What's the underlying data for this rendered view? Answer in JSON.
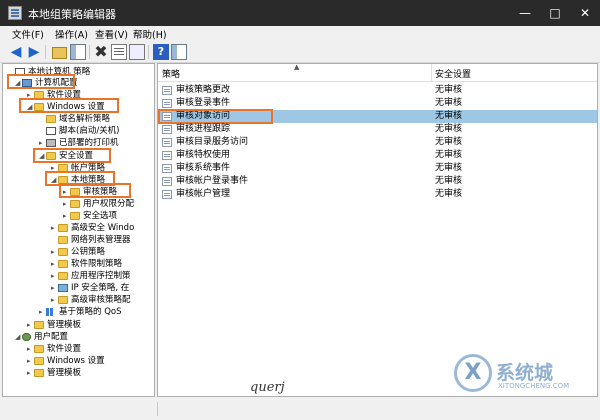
{
  "window": {
    "title": "本地组策略编辑器"
  },
  "menu": [
    "文件(F)",
    "操作(A)",
    "查看(V)",
    "帮助(H)"
  ],
  "toolbar": {
    "icons": [
      "back-arrow-icon",
      "forward-arrow-icon",
      "up-folder-icon",
      "show-hide-tree-icon",
      "delete-icon",
      "properties-icon",
      "export-list-icon",
      "help-icon",
      "show-hide-action-pane-icon"
    ]
  },
  "tree": [
    {
      "label": "本地计算机 策略",
      "icon": "script",
      "expander": ""
    },
    {
      "label": "计算机配置",
      "icon": "computer",
      "expander": "◢"
    },
    {
      "label": "软件设置",
      "icon": "folder",
      "expander": "▸"
    },
    {
      "label": "Windows 设置",
      "icon": "folder",
      "expander": "◢"
    },
    {
      "label": "域名解析策略",
      "icon": "folder",
      "expander": ""
    },
    {
      "label": "脚本(启动/关机)",
      "icon": "script",
      "expander": ""
    },
    {
      "label": "已部署的打印机",
      "icon": "printer",
      "expander": "▸"
    },
    {
      "label": "安全设置",
      "icon": "folder",
      "expander": "◢"
    },
    {
      "label": "帐户策略",
      "icon": "folder",
      "expander": "▸"
    },
    {
      "label": "本地策略",
      "icon": "folder",
      "expander": "◢"
    },
    {
      "label": "审核策略",
      "icon": "folder",
      "expander": "▸"
    },
    {
      "label": "用户权限分配",
      "icon": "folder",
      "expander": "▸"
    },
    {
      "label": "安全选项",
      "icon": "folder",
      "expander": "▸"
    },
    {
      "label": "高级安全 Windo",
      "icon": "folder",
      "expander": "▸"
    },
    {
      "label": "网络列表管理器",
      "icon": "folder",
      "expander": ""
    },
    {
      "label": "公钥策略",
      "icon": "folder",
      "expander": "▸"
    },
    {
      "label": "软件限制策略",
      "icon": "folder",
      "expander": "▸"
    },
    {
      "label": "应用程序控制策",
      "icon": "folder",
      "expander": "▸"
    },
    {
      "label": "IP 安全策略, 在",
      "icon": "net",
      "expander": "▸"
    },
    {
      "label": "高级审核策略配",
      "icon": "folder",
      "expander": "▸"
    },
    {
      "label": "基于策略的 QoS",
      "icon": "bars",
      "expander": "▸"
    },
    {
      "label": "管理模板",
      "icon": "folder",
      "expander": "▸"
    },
    {
      "label": "用户配置",
      "icon": "user",
      "expander": "◢"
    },
    {
      "label": "软件设置",
      "icon": "folder",
      "expander": "▸"
    },
    {
      "label": "Windows 设置",
      "icon": "folder",
      "expander": "▸"
    },
    {
      "label": "管理模板",
      "icon": "folder",
      "expander": "▸"
    }
  ],
  "list": {
    "col_policy": "策略",
    "col_setting": "安全设置",
    "sort_glyph": "▲",
    "rows": [
      {
        "policy": "审核策略更改",
        "setting": "无审核"
      },
      {
        "policy": "审核登录事件",
        "setting": "无审核"
      },
      {
        "policy": "审核对象访问",
        "setting": "无审核"
      },
      {
        "policy": "审核进程跟踪",
        "setting": "无审核"
      },
      {
        "policy": "审核目录服务访问",
        "setting": "无审核"
      },
      {
        "policy": "审核特权使用",
        "setting": "无审核"
      },
      {
        "policy": "审核系统事件",
        "setting": "无审核"
      },
      {
        "policy": "审核帐户登录事件",
        "setting": "无审核"
      },
      {
        "policy": "审核帐户管理",
        "setting": "无审核"
      }
    ],
    "selected_index": 2
  },
  "watermarks": {
    "signature": "querj",
    "logo_text": "系统城",
    "logo_sub": "XITONGCHENG.COM",
    "logo_letter": "X"
  },
  "colors": {
    "titlebar": "#2a2a2a",
    "selection": "#9ec7e6",
    "highlight_box": "#e8742a"
  }
}
